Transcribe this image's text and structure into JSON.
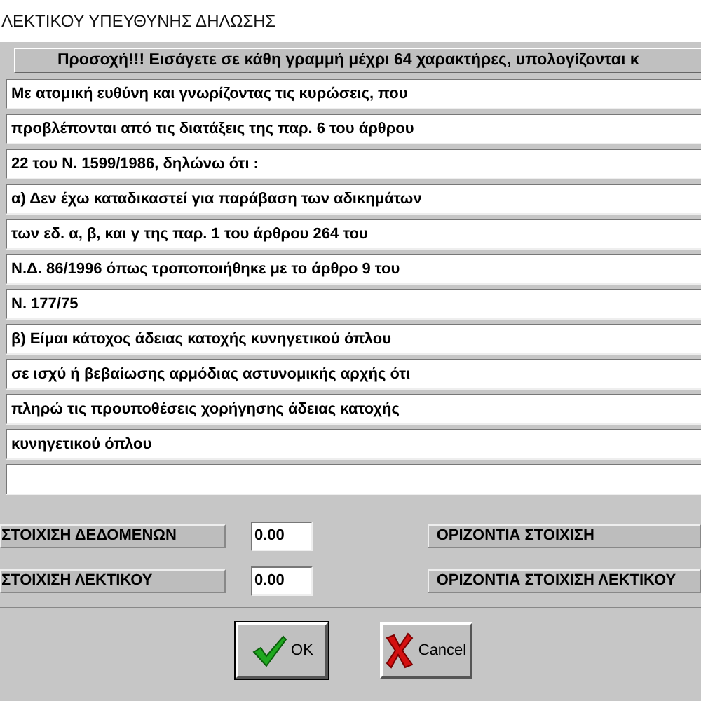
{
  "window": {
    "title": "ΛΕΚΤΙΚΟΥ ΥΠΕΥΘΥΝΗΣ ΔΗΛΩΣΗΣ"
  },
  "banner": "Προσοχή!!! Εισάγετε σε κάθη γραμμή μέχρι 64 χαρακτήρες, υπολογίζονται κ",
  "lines": [
    "Με ατομική ευθύνη και γνωρίζοντας τις κυρώσεις, που",
    "προβλέπονται από τις διατάξεις της παρ. 6 του άρθρου",
    "22 του Ν. 1599/1986, δηλώνω ότι :",
    "α) Δεν έχω καταδικαστεί για παράβαση των αδικημάτων",
    "των εδ. α, β, και γ της παρ. 1 του άρθρου 264 του",
    "Ν.Δ. 86/1996 όπως τροποποιήθηκε με το άρθρο 9 του",
    "Ν. 177/75",
    "β) Είμαι κάτοχος άδειας κατοχής κυνηγετικού όπλου",
    "σε ισχύ ή βεβαίωσης αρμόδιας αστυνομικής αρχής ότι",
    "πληρώ τις προυποθέσεις χορήγησης άδειας κατοχής",
    "κυνηγετικού όπλου"
  ],
  "settings": [
    {
      "label": "ΣΤΟΙΧΙΣΗ ΔΕΔΟΜΕΝΩΝ",
      "value": "0.00",
      "right_label": "ΟΡΙΖΟΝΤΙΑ ΣΤΟΙΧΙΣΗ"
    },
    {
      "label": "ΣΤΟΙΧΙΣΗ ΛΕΚΤΙΚΟΥ",
      "value": "0.00",
      "right_label": "ΟΡΙΖΟΝΤΙΑ ΣΤΟΙΧΙΣΗ ΛΕΚΤΙΚΟΥ"
    }
  ],
  "buttons": [
    {
      "kind": "ok",
      "label": "OK"
    },
    {
      "kind": "cancel",
      "label": "Cancel"
    }
  ]
}
